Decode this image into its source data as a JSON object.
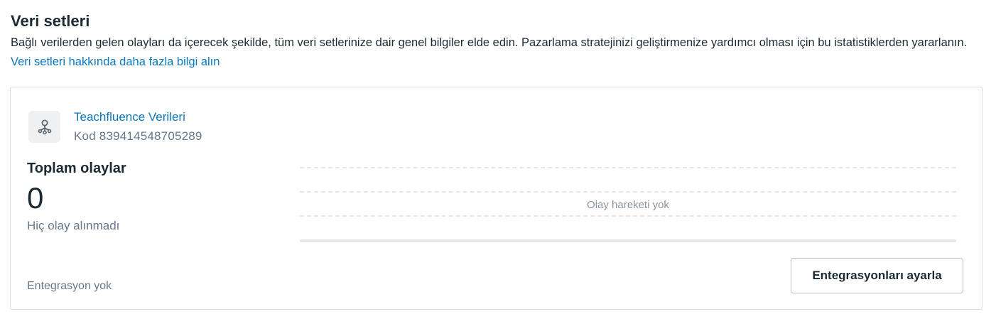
{
  "header": {
    "title": "Veri setleri",
    "description": "Bağlı verilerden gelen olayları da içerecek şekilde, tüm veri setlerinize dair genel bilgiler elde edin. Pazarlama stratejinizi geliştirmenize yardımcı olması için bu istatistiklerden yararlanın.",
    "learn_more_link": "Veri setleri hakkında daha fazla bilgi alın"
  },
  "dataset": {
    "icon": "dataset-network-icon",
    "name": "Teachfluence Verileri",
    "code": "Kod 839414548705289"
  },
  "totals": {
    "label": "Toplam olaylar",
    "value": "0",
    "subtext": "Hiç olay alınmadı"
  },
  "chart_data": {
    "type": "line",
    "series": [],
    "empty_message": "Olay hareketi yok",
    "grid": true
  },
  "footer": {
    "integration_status": "Entegrasyon yok",
    "setup_button_label": "Entegrasyonları ayarla"
  },
  "colors": {
    "link": "#0a78be",
    "text_primary": "#1c2b33",
    "text_secondary": "#67788a",
    "border": "#dadde1"
  }
}
